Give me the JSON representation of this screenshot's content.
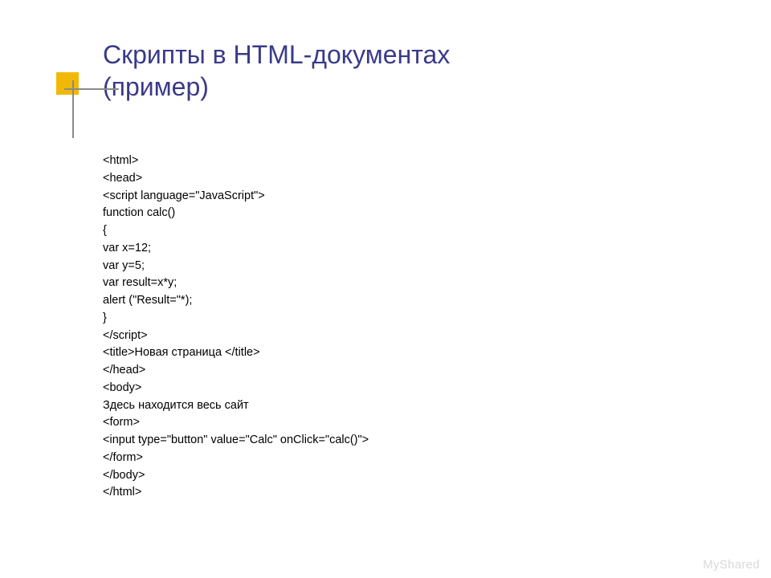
{
  "title_line1": "Скрипты в HTML-документах",
  "title_line2": "(пример)",
  "code_lines": [
    "<html>",
    "<head>",
    "<script language=\"JavaScript\">",
    "function calc()",
    "{",
    "var x=12;",
    "var y=5;",
    "var result=x*y;",
    "alert (\"Result=\"*);",
    "}",
    "</script>",
    "<title>Новая страница </title>",
    "</head>",
    "<body>",
    "Здесь находится весь сайт",
    "<form>",
    "<input type=\"button\" value=\"Calc\" onClick=\"calc()\">",
    "</form>",
    "</body>",
    "</html>"
  ],
  "watermark": "MyShared"
}
